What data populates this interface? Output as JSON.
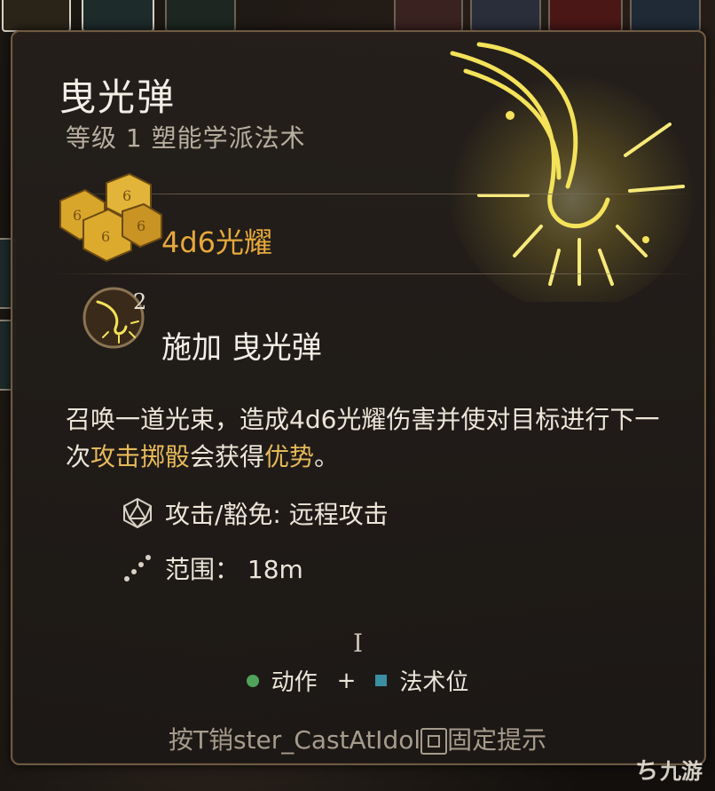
{
  "spell": {
    "name": "曳光弹",
    "subtitle": "等级 1 塑能学派法术",
    "damage": "4d6光耀",
    "cast_count": "2",
    "cast_label": "施加 曳光弹"
  },
  "description": {
    "part1": "召唤一道光束，造成4d6光耀伤害并使对目标进行下一次",
    "keyword1": "攻击掷骰",
    "part2": "会获得",
    "keyword2": "优势",
    "part3": "。"
  },
  "properties": [
    {
      "icon": "d20-icon",
      "text": "攻击/豁免: 远程攻击"
    },
    {
      "icon": "range-icon",
      "text": "范围： 18m"
    }
  ],
  "cursor": "I",
  "cost": {
    "action_label": "动作",
    "plus": "+",
    "slot_label": "法术位"
  },
  "hint": {
    "prefix": "按",
    "middle": "T销ster_CastAtIdol",
    "suffix": "固定提示"
  },
  "watermark": "九游",
  "colors": {
    "damage": "#e6a93c",
    "keyword": "#e6b95a",
    "action_dot": "#4fa35a",
    "slot_square": "#3a8fa3"
  }
}
